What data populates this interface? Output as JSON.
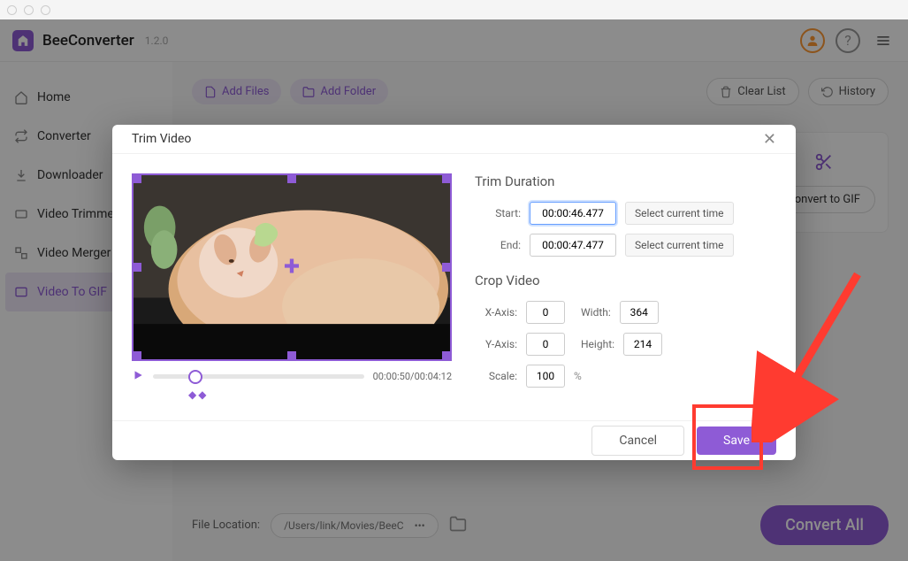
{
  "app": {
    "name": "BeeConverter",
    "version": "1.2.0"
  },
  "sidebar": {
    "items": [
      {
        "label": "Home"
      },
      {
        "label": "Converter"
      },
      {
        "label": "Downloader"
      },
      {
        "label": "Video Trimmer"
      },
      {
        "label": "Video Merger"
      },
      {
        "label": "Video To GIF"
      }
    ]
  },
  "toolbar": {
    "add_files": "Add Files",
    "add_folder": "Add Folder",
    "clear_list": "Clear List",
    "history": "History"
  },
  "conversion": {
    "convert_to_gif": "Convert to GIF",
    "convert_all": "Convert All"
  },
  "footer": {
    "file_location_label": "File Location:",
    "file_path": "/Users/link/Movies/BeeC",
    "more": "•••"
  },
  "modal": {
    "title": "Trim Video",
    "trim": {
      "section": "Trim Duration",
      "start_label": "Start:",
      "start_value": "00:00:46.477",
      "end_label": "End:",
      "end_value": "00:00:47.477",
      "select_time": "Select current time"
    },
    "crop": {
      "section": "Crop Video",
      "x_label": "X-Axis:",
      "x_value": "0",
      "width_label": "Width:",
      "width_value": "364",
      "y_label": "Y-Axis:",
      "y_value": "0",
      "height_label": "Height:",
      "height_value": "214",
      "scale_label": "Scale:",
      "scale_value": "100",
      "scale_unit": "%"
    },
    "playback": {
      "current": "00:00:50",
      "total": "00:04:12"
    },
    "cancel": "Cancel",
    "save": "Save"
  }
}
